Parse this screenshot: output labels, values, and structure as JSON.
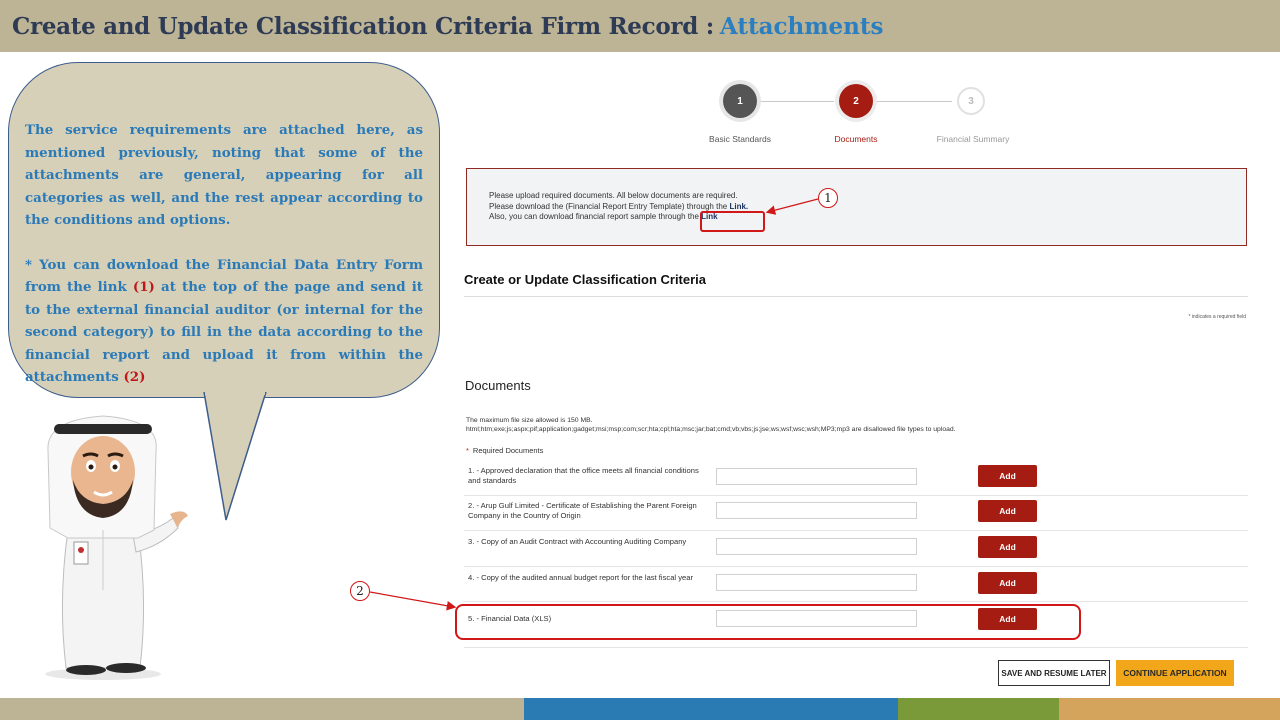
{
  "header": {
    "title": "Create and Update Classification Criteria Firm Record :",
    "accent": "Attachments"
  },
  "bubble": {
    "paragraph1": "The service requirements are attached here, as mentioned previously, noting that some of the attachments are general, appearing for all categories as well, and the rest appear according to the conditions and options.",
    "p2_part1": "* You can download the Financial Data Entry Form from the link",
    "p2_num1": "(1)",
    "p2_part2": "at the top of the page and send it to the external financial auditor (or internal for the second category) to fill in the data according to the financial report and upload it from within the attachments",
    "p2_num2": "(2)"
  },
  "stepper": {
    "steps": [
      {
        "number": "1",
        "label": "Basic Standards",
        "state": "done"
      },
      {
        "number": "2",
        "label": "Documents",
        "state": "active"
      },
      {
        "number": "3",
        "label": "Financial Summary",
        "state": "pending"
      }
    ]
  },
  "info": {
    "line1": "Please upload required documents. All below documents are required.",
    "line2_prefix": "Please download the (Financial Report Entry Template) through the",
    "line2_link": "Link.",
    "line3_prefix": "Also, you can download financial report sample through the",
    "line3_link": "Link"
  },
  "callouts": {
    "one": "1",
    "two": "2"
  },
  "section": {
    "title": "Create or Update Classification Criteria",
    "required_note": "* indicates a required field"
  },
  "documents": {
    "title": "Documents",
    "filesize_line1": "The maximum file size allowed is 150 MB.",
    "filesize_line2": "html;htm;exe;js;aspx;pif;application;gadget;msi;msp;com;scr;hta;cpl;hta;msc;jar;bat;cmd;vb;vbs;js;jse;ws;wsf;wsc;wsh;MP3;mp3 are disallowed file types to upload.",
    "required_star": "*",
    "required_label": "Required Documents",
    "add_label": "Add",
    "rows": [
      {
        "label": "1. - Approved declaration that the office meets all financial conditions and standards"
      },
      {
        "label": "2. - Arup Gulf Limited - Certificate of Establishing the Parent Foreign Company in the Country of Origin"
      },
      {
        "label": "3. - Copy of an Audit Contract with Accounting Auditing Company"
      },
      {
        "label": "4. - Copy of the audited annual budget report for the last fiscal year"
      },
      {
        "label": "5. - Financial Data (XLS)"
      }
    ]
  },
  "actions": {
    "save": "SAVE AND RESUME LATER",
    "continue": "CONTINUE APPLICATION"
  },
  "colors": {
    "header_bg": "#bdb395",
    "bubble_bg": "#d7d0b8",
    "bubble_text": "#2a7ab8",
    "brand_red": "#a51c12",
    "continue_bg": "#f2a71a",
    "bar": [
      "#bdb395",
      "#2a7ab4",
      "#7a9a3a",
      "#d4a45c"
    ]
  }
}
